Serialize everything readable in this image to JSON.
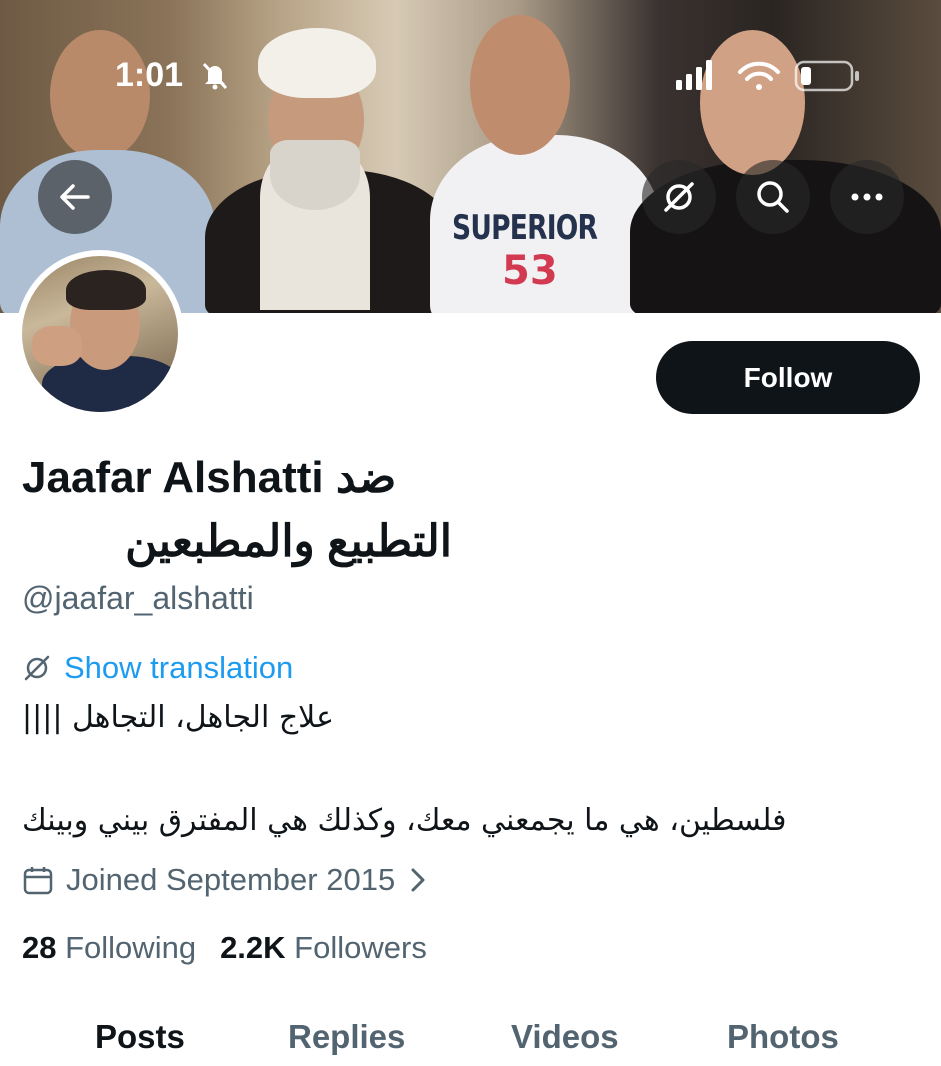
{
  "status_bar": {
    "time": "1:01",
    "icons": [
      "bell-slash-icon",
      "signal-icon",
      "wifi-icon",
      "battery-icon"
    ]
  },
  "header": {
    "back_icon": "arrow-left-icon",
    "actions": [
      "translate-icon",
      "search-icon",
      "more-icon"
    ]
  },
  "banner": {
    "shirt_text": "SUPERIOR",
    "shirt_number": "53"
  },
  "profile": {
    "follow_label": "Follow",
    "display_name_line1": "Jaafar Alshatti ضد",
    "display_name_line2": "التطبيع والمطبعين",
    "handle": "@jaafar_alshatti",
    "show_translation": "Show translation",
    "bio_line1": "علاج الجاهل، التجاهل ||||",
    "bio_line2": "فلسطين، هي ما يجمعني معك، وكذلك هي المفترق بيني وبينك",
    "joined": "Joined September 2015",
    "following_count": "28",
    "following_label": "Following",
    "followers_count": "2.2K",
    "followers_label": "Followers"
  },
  "tabs": [
    {
      "label": "Posts",
      "active": true
    },
    {
      "label": "Replies",
      "active": false
    },
    {
      "label": "Videos",
      "active": false
    },
    {
      "label": "Photos",
      "active": false
    }
  ],
  "colors": {
    "accent": "#1d9bf0",
    "text_primary": "#0f1419",
    "text_secondary": "#536471",
    "follow_bg": "#0f1419"
  }
}
